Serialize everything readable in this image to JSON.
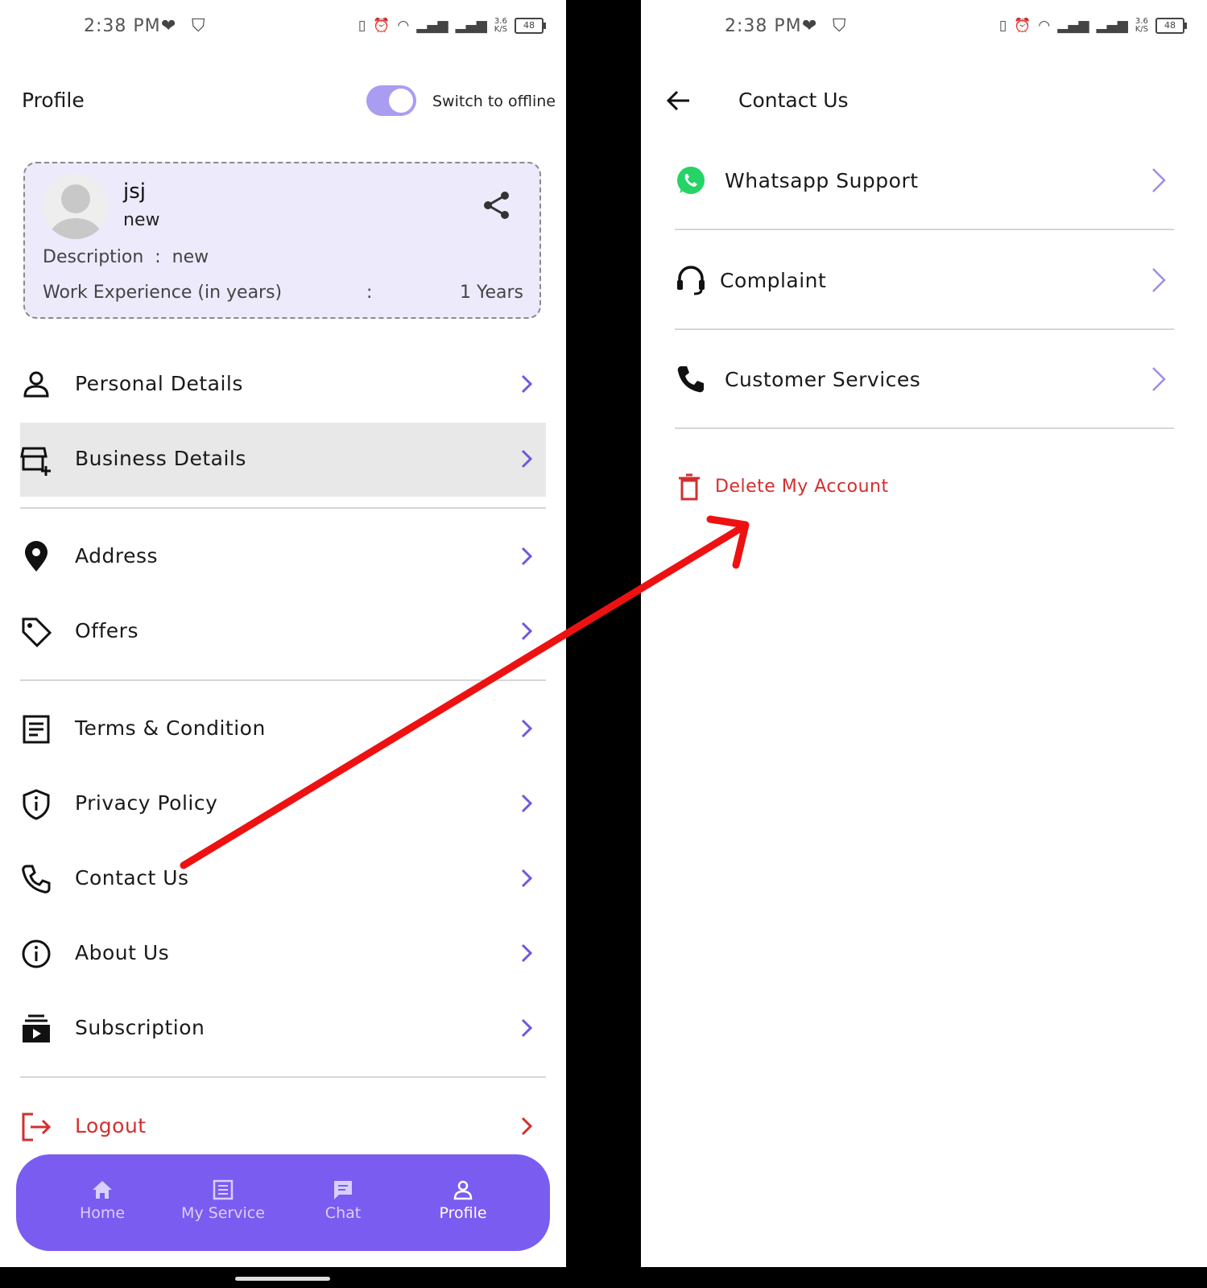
{
  "status_bar": {
    "time": "2:38 PM",
    "speed_top": "3.6",
    "speed_bottom": "K/S",
    "battery": "48"
  },
  "profile_screen": {
    "title": "Profile",
    "offline_toggle": {
      "label": "Switch to offline",
      "on": true
    },
    "profile_card": {
      "name": "jsj",
      "subtitle": "new",
      "description_label": "Description  :  new",
      "experience_label": "Work Experience (in years)",
      "experience_colon": ":",
      "experience_value": "1 Years"
    },
    "menu": [
      {
        "label": "Personal Details",
        "icon": "person-icon"
      },
      {
        "label": "Business Details",
        "icon": "store-add-icon",
        "active": true
      },
      {
        "label": "Address",
        "icon": "location-pin-icon"
      },
      {
        "label": "Offers",
        "icon": "tag-icon"
      },
      {
        "label": "Terms & Condition",
        "icon": "document-icon"
      },
      {
        "label": "Privacy Policy",
        "icon": "shield-info-icon"
      },
      {
        "label": "Contact Us",
        "icon": "phone-icon"
      },
      {
        "label": "About Us",
        "icon": "info-icon"
      },
      {
        "label": "Subscription",
        "icon": "subscription-icon"
      },
      {
        "label": "Logout",
        "icon": "logout-icon"
      }
    ],
    "bottom_nav": [
      {
        "label": "Home",
        "icon": "home-icon"
      },
      {
        "label": "My Service",
        "icon": "list-icon"
      },
      {
        "label": "Chat",
        "icon": "chat-icon"
      },
      {
        "label": "Profile",
        "icon": "person-icon",
        "selected": true
      }
    ]
  },
  "contact_screen": {
    "title": "Contact Us",
    "items": [
      {
        "label": "Whatsapp Support",
        "icon": "whatsapp-icon"
      },
      {
        "label": "Complaint",
        "icon": "headset-icon"
      },
      {
        "label": "Customer Services",
        "icon": "phone-icon"
      }
    ],
    "delete_label": "Delete My Account"
  },
  "colors": {
    "accent": "#7b5cf0",
    "toggle": "#a99df2",
    "card_bg": "#eceafb",
    "danger": "#d32f2f",
    "annotation_arrow": "#ee1111",
    "whatsapp": "#25d366"
  }
}
